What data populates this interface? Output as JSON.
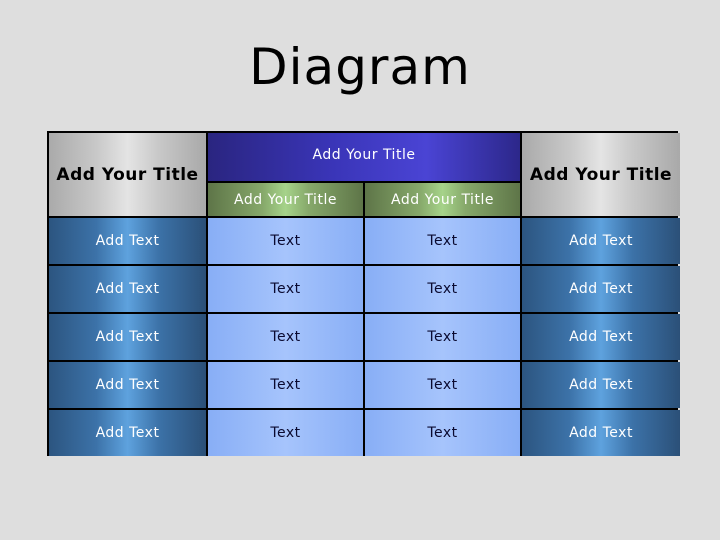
{
  "page_title": "Diagram",
  "table": {
    "left_header": "Add Your Title",
    "right_header": "Add Your Title",
    "group_header": "Add Your Title",
    "sub_headers": [
      "Add Your Title",
      "Add Your Title"
    ],
    "rows": [
      [
        "Add Text",
        "Text",
        "Text",
        "Add Text"
      ],
      [
        "Add Text",
        "Text",
        "Text",
        "Add Text"
      ],
      [
        "Add Text",
        "Text",
        "Text",
        "Add Text"
      ],
      [
        "Add Text",
        "Text",
        "Text",
        "Add Text"
      ],
      [
        "Add Text",
        "Text",
        "Text",
        "Add Text"
      ]
    ]
  },
  "colors": {
    "background": "#dedede",
    "group_header": "#3a35b8",
    "sub_header": "#86a86a",
    "side_column": "#3c72a8",
    "middle_cells": "#a6c4fc",
    "outer_header": "#c8c8c8"
  }
}
